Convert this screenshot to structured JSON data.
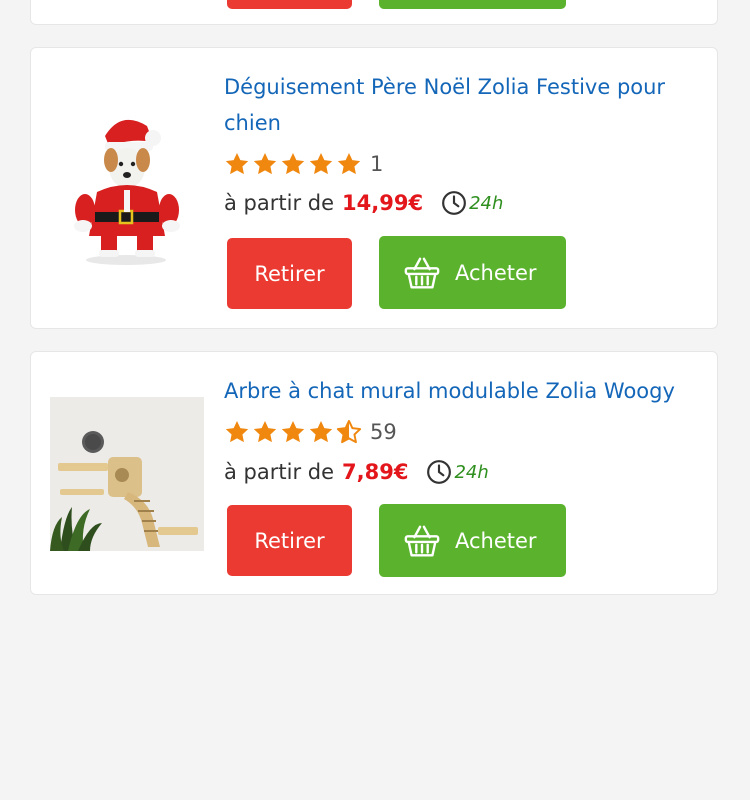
{
  "colors": {
    "link": "#1466b8",
    "price": "#e3161b",
    "star": "#f0870f",
    "remove_button": "#eb3a32",
    "buy_button": "#5bb32d",
    "delivery": "#2f8f1f"
  },
  "products": [
    {
      "title": "Déguisement Père Noël Zolia Festive pour chien",
      "rating": 5,
      "review_count": "1",
      "price_prefix": "à partir de",
      "price": "14,99€",
      "delivery": "24h",
      "remove_label": "Retirer",
      "buy_label": "Acheter",
      "image_icon": "santa-dog-costume-image"
    },
    {
      "title": "Arbre à chat mural modulable Zolia Woogy",
      "rating": 4.5,
      "review_count": "59",
      "price_prefix": "à partir de",
      "price": "7,89€",
      "delivery": "24h",
      "remove_label": "Retirer",
      "buy_label": "Acheter",
      "image_icon": "wall-cat-tree-image"
    }
  ]
}
